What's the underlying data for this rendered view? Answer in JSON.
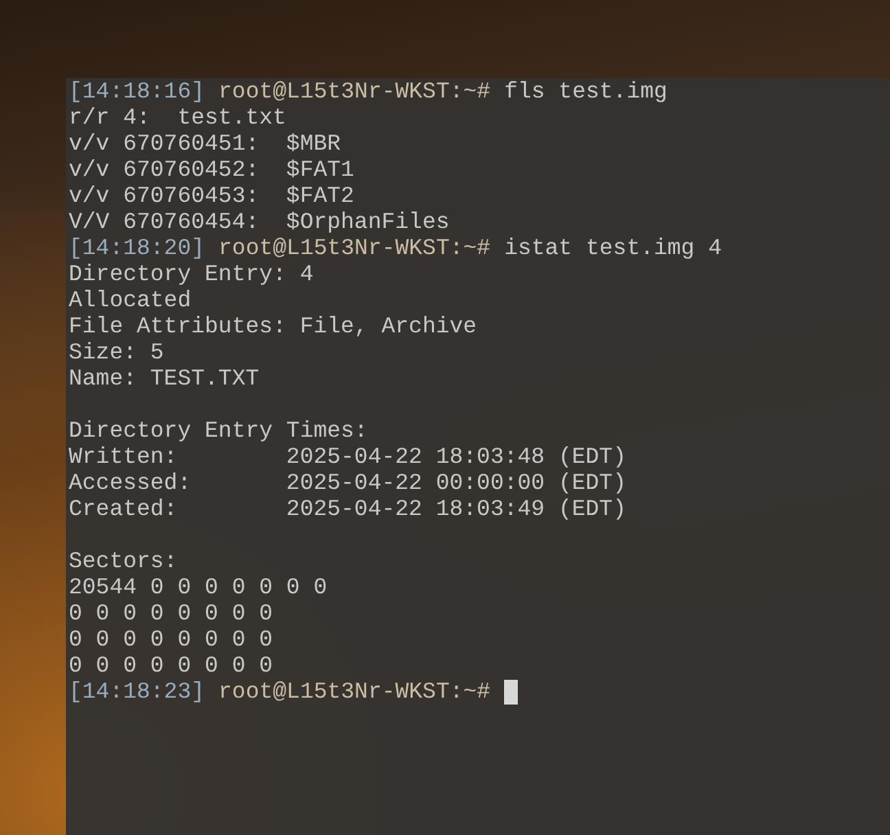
{
  "terminal": {
    "lines": [
      {
        "kind": "prompt",
        "time": "[14:18:16]",
        "user": "root@L15t3Nr-WKST:~#",
        "command": "fls test.img",
        "cursor": false
      },
      {
        "kind": "output",
        "text": "r/r 4:  test.txt"
      },
      {
        "kind": "output",
        "text": "v/v 670760451:  $MBR"
      },
      {
        "kind": "output",
        "text": "v/v 670760452:  $FAT1"
      },
      {
        "kind": "output",
        "text": "v/v 670760453:  $FAT2"
      },
      {
        "kind": "output",
        "text": "V/V 670760454:  $OrphanFiles"
      },
      {
        "kind": "prompt",
        "time": "[14:18:20]",
        "user": "root@L15t3Nr-WKST:~#",
        "command": "istat test.img 4",
        "cursor": false
      },
      {
        "kind": "output",
        "text": "Directory Entry: 4"
      },
      {
        "kind": "output",
        "text": "Allocated"
      },
      {
        "kind": "output",
        "text": "File Attributes: File, Archive"
      },
      {
        "kind": "output",
        "text": "Size: 5"
      },
      {
        "kind": "output",
        "text": "Name: TEST.TXT"
      },
      {
        "kind": "blank"
      },
      {
        "kind": "output",
        "text": "Directory Entry Times:"
      },
      {
        "kind": "output",
        "text": "Written:        2025-04-22 18:03:48 (EDT)"
      },
      {
        "kind": "output",
        "text": "Accessed:       2025-04-22 00:00:00 (EDT)"
      },
      {
        "kind": "output",
        "text": "Created:        2025-04-22 18:03:49 (EDT)"
      },
      {
        "kind": "blank"
      },
      {
        "kind": "output",
        "text": "Sectors:"
      },
      {
        "kind": "output",
        "text": "20544 0 0 0 0 0 0 0"
      },
      {
        "kind": "output",
        "text": "0 0 0 0 0 0 0 0"
      },
      {
        "kind": "output",
        "text": "0 0 0 0 0 0 0 0"
      },
      {
        "kind": "output",
        "text": "0 0 0 0 0 0 0 0"
      },
      {
        "kind": "prompt",
        "time": "[14:18:23]",
        "user": "root@L15t3Nr-WKST:~#",
        "cursor": true
      }
    ]
  }
}
